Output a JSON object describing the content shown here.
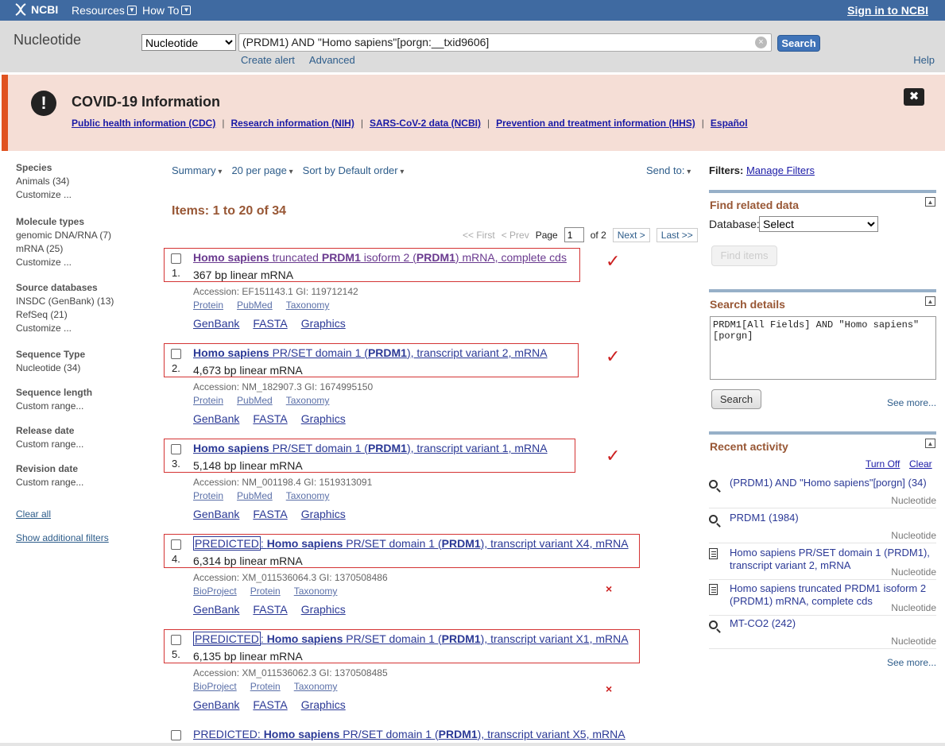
{
  "topbar": {
    "logo": "NCBI",
    "menus": [
      "Resources",
      "How To"
    ],
    "signin": "Sign in to NCBI"
  },
  "search": {
    "db_title": "Nucleotide",
    "db_selected": "Nucleotide",
    "term": "(PRDM1) AND \"Homo sapiens\"[porgn:__txid9606]",
    "button": "Search",
    "create_alert": "Create alert",
    "advanced": "Advanced",
    "help": "Help"
  },
  "covid": {
    "title": "COVID-19 Information",
    "links": [
      "Public health information (CDC)",
      "Research information (NIH)",
      "SARS-CoV-2 data (NCBI)",
      "Prevention and treatment information (HHS)",
      "Español"
    ],
    "sep": "|"
  },
  "filters": {
    "groups": [
      {
        "header": "Species",
        "items": [
          "Animals (34)",
          "Customize ..."
        ]
      },
      {
        "header": "Molecule types",
        "items": [
          "genomic DNA/RNA (7)",
          "mRNA (25)",
          "Customize ..."
        ]
      },
      {
        "header": "Source databases",
        "items": [
          "INSDC (GenBank) (13)",
          "RefSeq (21)",
          "Customize ..."
        ]
      },
      {
        "header": "Sequence Type",
        "items": [
          "Nucleotide (34)"
        ]
      },
      {
        "header": "Sequence length",
        "items": [
          "Custom range..."
        ]
      },
      {
        "header": "Release date",
        "items": [
          "Custom range..."
        ]
      },
      {
        "header": "Revision date",
        "items": [
          "Custom range..."
        ]
      }
    ],
    "clear_all": "Clear all",
    "show_additional": "Show additional filters"
  },
  "toolbar": {
    "summary": "Summary",
    "per_page": "20 per page",
    "sort": "Sort by Default order",
    "send_to": "Send to:"
  },
  "results_header": "Items: 1 to 20 of 34",
  "pager": {
    "first": "<< First",
    "prev": "< Prev",
    "page_label": "Page",
    "page": "1",
    "of": "of 2",
    "next": "Next >",
    "last": "Last >>"
  },
  "results": [
    {
      "num": "1.",
      "title_parts": [
        [
          "b",
          "Homo sapiens"
        ],
        [
          "t",
          " truncated "
        ],
        [
          "b",
          "PRDM1"
        ],
        [
          "t",
          " isoform 2 ("
        ],
        [
          "b",
          "PRDM1"
        ],
        [
          "t",
          ") mRNA, complete cds"
        ]
      ],
      "desc": "367 bp linear mRNA",
      "acc": "Accession: EF151143.1   GI: 119712142",
      "links": [
        "Protein",
        "PubMed",
        "Taxonomy"
      ],
      "links2": [
        "GenBank",
        "FASTA",
        "Graphics"
      ],
      "mark": "✓"
    },
    {
      "num": "2.",
      "title_parts": [
        [
          "b",
          "Homo sapiens"
        ],
        [
          "t",
          " PR/SET domain 1 ("
        ],
        [
          "b",
          "PRDM1"
        ],
        [
          "t",
          "), transcript variant 2, mRNA"
        ]
      ],
      "desc": "4,673 bp linear mRNA",
      "acc": "Accession: NM_182907.3   GI: 1674995150",
      "links": [
        "Protein",
        "PubMed",
        "Taxonomy"
      ],
      "links2": [
        "GenBank",
        "FASTA",
        "Graphics"
      ],
      "mark": "✓"
    },
    {
      "num": "3.",
      "title_parts": [
        [
          "b",
          "Homo sapiens"
        ],
        [
          "t",
          " PR/SET domain 1 ("
        ],
        [
          "b",
          "PRDM1"
        ],
        [
          "t",
          "), transcript variant 1, mRNA"
        ]
      ],
      "desc": "5,148 bp linear mRNA",
      "acc": "Accession: NM_001198.4   GI: 1519313091",
      "links": [
        "Protein",
        "PubMed",
        "Taxonomy"
      ],
      "links2": [
        "GenBank",
        "FASTA",
        "Graphics"
      ],
      "mark": "✓"
    },
    {
      "num": "4.",
      "title_parts": [
        [
          "p",
          "PREDICTED"
        ],
        [
          "t",
          ": "
        ],
        [
          "b",
          "Homo sapiens"
        ],
        [
          "t",
          " PR/SET domain 1 ("
        ],
        [
          "b",
          "PRDM1"
        ],
        [
          "t",
          "), transcript variant X4, mRNA"
        ]
      ],
      "desc": "6,314 bp linear mRNA",
      "acc": "Accession: XM_011536064.3   GI: 1370508486",
      "links": [
        "BioProject",
        "Protein",
        "Taxonomy"
      ],
      "links2": [
        "GenBank",
        "FASTA",
        "Graphics"
      ],
      "mark": "×"
    },
    {
      "num": "5.",
      "title_parts": [
        [
          "p",
          "PREDICTED"
        ],
        [
          "t",
          ": "
        ],
        [
          "b",
          "Homo sapiens"
        ],
        [
          "t",
          " PR/SET domain 1 ("
        ],
        [
          "b",
          "PRDM1"
        ],
        [
          "t",
          "), transcript variant X1, mRNA"
        ]
      ],
      "desc": "6,135 bp linear mRNA",
      "acc": "Accession: XM_011536062.3   GI: 1370508485",
      "links": [
        "BioProject",
        "Protein",
        "Taxonomy"
      ],
      "links2": [
        "GenBank",
        "FASTA",
        "Graphics"
      ],
      "mark": "×"
    },
    {
      "num": "",
      "title_parts": [
        [
          "t",
          "PREDICTED: "
        ],
        [
          "b",
          "Homo sapiens"
        ],
        [
          "t",
          " PR/SET domain 1 ("
        ],
        [
          "b",
          "PRDM1"
        ],
        [
          "t",
          "), transcript variant X5, mRNA"
        ]
      ],
      "desc": "",
      "acc": "",
      "links": [],
      "links2": [],
      "mark": ""
    }
  ],
  "right": {
    "filters_label": "Filters:",
    "manage_filters": "Manage Filters",
    "find_related": "Find related data",
    "database_label": "Database:",
    "database_selected": "Select",
    "find_items": "Find items",
    "search_details": "Search details",
    "details_text": "PRDM1[All Fields] AND \"Homo sapiens\"\n[porgn]",
    "details_search": "Search",
    "see_more": "See more...",
    "recent_activity": "Recent activity",
    "turn_off": "Turn Off",
    "clear": "Clear",
    "recent": [
      {
        "icon": "search-icon",
        "text": "(PRDM1) AND \"Homo sapiens\"[porgn] (34)",
        "db": "Nucleotide"
      },
      {
        "icon": "search-icon",
        "text": "PRDM1 (1984)",
        "db": "Nucleotide"
      },
      {
        "icon": "document-icon",
        "text": "Homo sapiens PR/SET domain 1 (PRDM1), transcript variant 2, mRNA",
        "db": "Nucleotide"
      },
      {
        "icon": "document-icon",
        "text": "Homo sapiens truncated PRDM1 isoform 2 (PRDM1) mRNA, complete cds",
        "db": "Nucleotide"
      },
      {
        "icon": "search-icon",
        "text": "MT-CO2 (242)",
        "db": "Nucleotide"
      }
    ],
    "see_more2": "See more..."
  }
}
